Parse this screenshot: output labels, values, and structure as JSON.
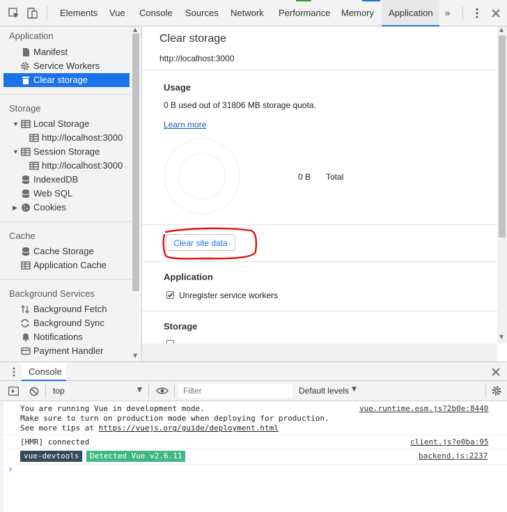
{
  "toolbar": {
    "tabs": [
      {
        "label": "Elements"
      },
      {
        "label": "Vue"
      },
      {
        "label": "Console"
      },
      {
        "label": "Sources"
      },
      {
        "label": "Network"
      },
      {
        "label": "Performance"
      },
      {
        "label": "Memory"
      },
      {
        "label": "Application"
      }
    ],
    "more_icon": "double-chevron-icon",
    "active_tab": "Application",
    "accent": "#1a73e8"
  },
  "sidebar": {
    "sections": [
      {
        "title": "Application"
      },
      {
        "title": "Storage"
      },
      {
        "title": "Cache"
      },
      {
        "title": "Background Services"
      }
    ],
    "items": [
      {
        "label": "Manifest"
      },
      {
        "label": "Service Workers"
      },
      {
        "label": "Clear storage"
      },
      {
        "label": "Local Storage"
      },
      {
        "label": "http://localhost:3000"
      },
      {
        "label": "Session Storage"
      },
      {
        "label": "http://localhost:3000"
      },
      {
        "label": "IndexedDB"
      },
      {
        "label": "Web SQL"
      },
      {
        "label": "Cookies"
      },
      {
        "label": "Cache Storage"
      },
      {
        "label": "Application Cache"
      },
      {
        "label": "Background Fetch"
      },
      {
        "label": "Background Sync"
      },
      {
        "label": "Notifications"
      },
      {
        "label": "Payment Handler"
      }
    ]
  },
  "main": {
    "title": "Clear storage",
    "url": "http://localhost:3000",
    "usage": {
      "heading": "Usage",
      "summary": "0 B used out of 31806 MB storage quota.",
      "learn_more": "Learn more",
      "legend_value": "0 B",
      "legend_label": "Total"
    },
    "clear_button": "Clear site data",
    "application": {
      "heading": "Application",
      "unregister": "Unregister service workers"
    },
    "storage": {
      "heading": "Storage"
    }
  },
  "drawer": {
    "tab": "Console"
  },
  "console": {
    "context": "top",
    "filter_placeholder": "Filter",
    "levels": "Default levels",
    "messages": [
      {
        "lines": [
          "You are running Vue in development mode.",
          "Make sure to turn on production mode when deploying for production.",
          "See more tips at https://vuejs.org/guide/deployment.html"
        ],
        "source": "vue.runtime.esm.js?2b0e:8440"
      },
      {
        "lines": [
          "[HMR] connected"
        ],
        "source": "client.js?e0ba:95"
      },
      {
        "badge_left": "vue-devtools",
        "badge_right": "Detected Vue v2.6.11",
        "source": "backend.js:2237"
      }
    ],
    "tip_prefix": "See more tips at ",
    "tip_link": "https://vuejs.org/guide/deployment.html",
    "colors": {
      "badge_dark": "#35495e",
      "badge_green": "#41b883"
    }
  },
  "annotation_color": "#e01010"
}
